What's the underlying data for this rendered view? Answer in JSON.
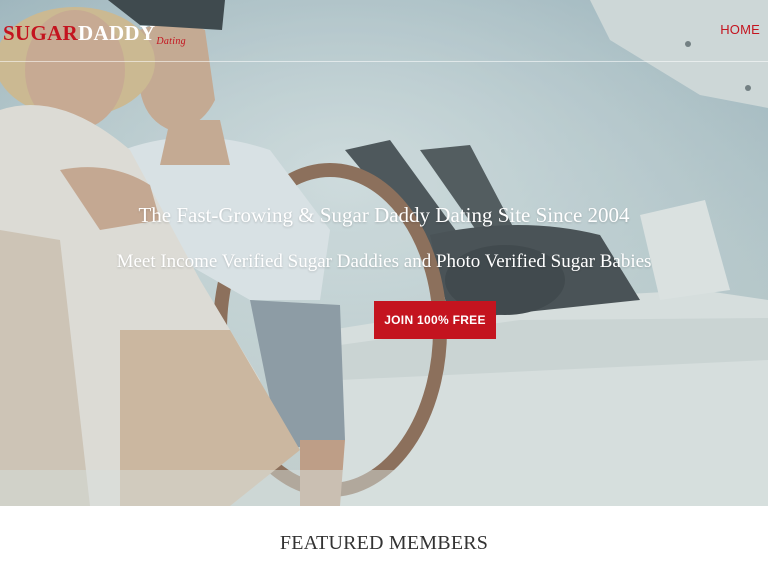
{
  "header": {
    "logo": {
      "sugar": "SUGAR",
      "daddy": "DADDY",
      "dating": "Dating"
    },
    "nav": {
      "home": "HOME"
    }
  },
  "hero": {
    "headline": "The Fast-Growing & Sugar Daddy Dating Site Since 2004",
    "subline": "Meet Income Verified Sugar Daddies and Photo Verified Sugar Babies",
    "cta": "JOIN 100% FREE"
  },
  "featured": {
    "title": "FEATURED MEMBERS"
  },
  "colors": {
    "brand_red": "#c4141f",
    "text_dark": "#333333",
    "white": "#ffffff"
  },
  "icons": {
    "hero_photo": "couple-on-boat-photo"
  }
}
